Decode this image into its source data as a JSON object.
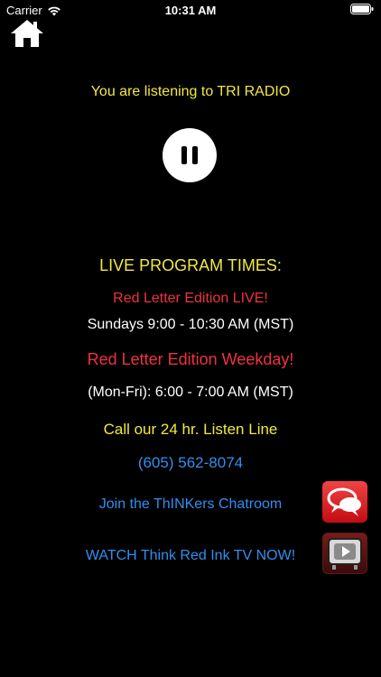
{
  "status_bar": {
    "carrier": "Carrier",
    "time": "10:31 AM",
    "icons": [
      "wifi-icon",
      "battery-icon"
    ]
  },
  "nav": {
    "home_icon": "home-icon"
  },
  "player": {
    "listening_text": "You are listening to TRI RADIO",
    "control": "pause"
  },
  "program": {
    "title": "LIVE PROGRAM TIMES:",
    "show1_name": "Red Letter Edition LIVE!",
    "show1_time": "Sundays 9:00 - 10:30 AM (MST)",
    "show2_name": "Red Letter Edition Weekday!",
    "show2_time": "(Mon-Fri): 6:00 - 7:00 AM (MST)"
  },
  "listen_line": {
    "label": "Call our 24 hr. Listen Line",
    "phone": "(605) 562-8074"
  },
  "links": {
    "chatroom": "Join the ThINKers Chatroom",
    "tv": "WATCH Think Red Ink TV NOW!"
  },
  "colors": {
    "background": "#000000",
    "yellow": "#f2e940",
    "red": "#f0323f",
    "blue": "#2f8ff0",
    "white": "#ffffff"
  }
}
